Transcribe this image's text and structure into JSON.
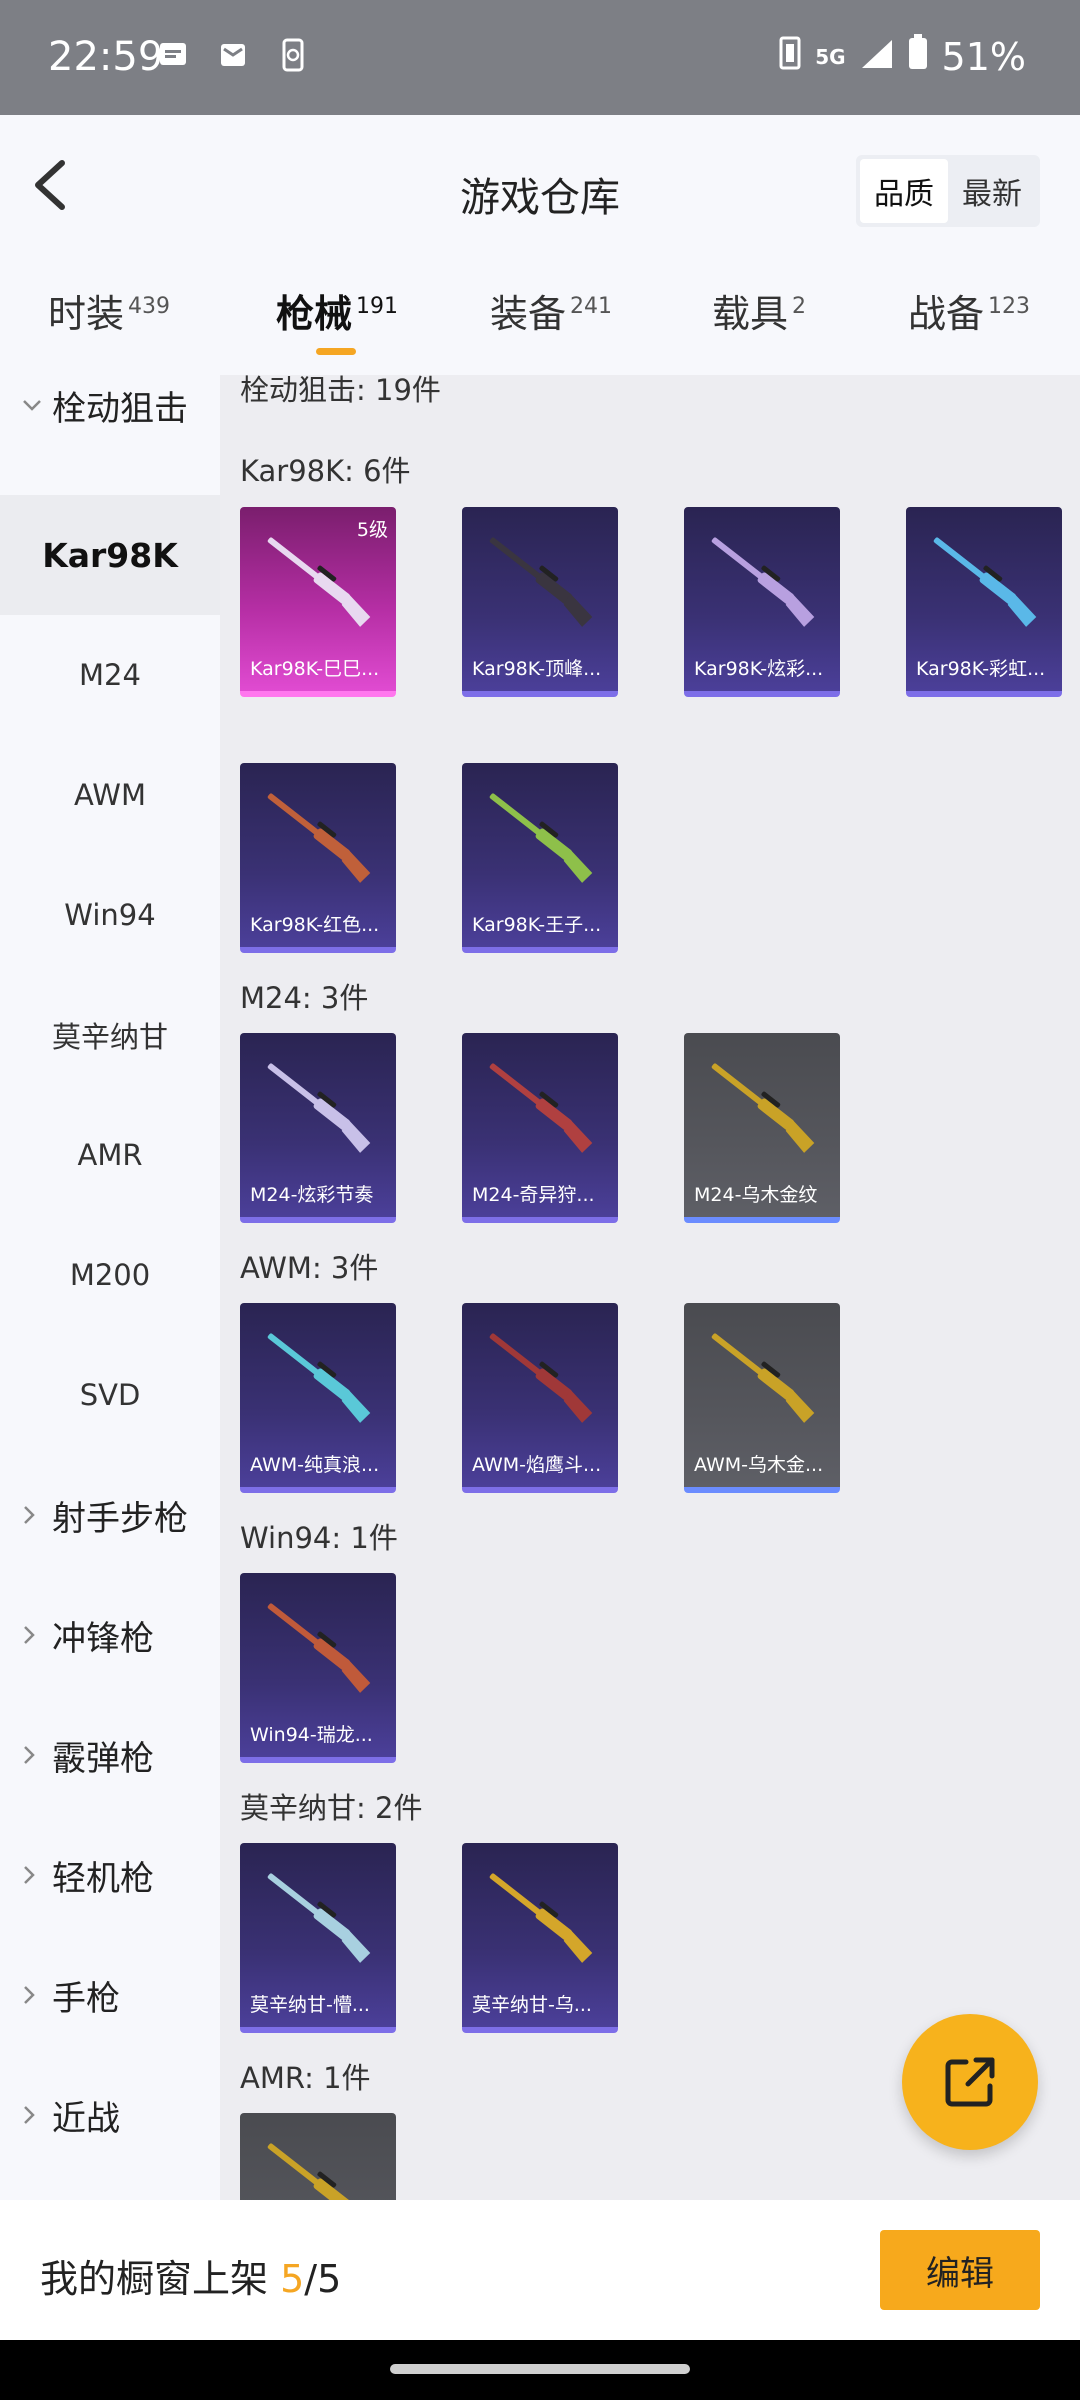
{
  "status_bar": {
    "time": "22:59",
    "icons_left": [
      "message-icon",
      "mail-icon",
      "phone-sync-icon"
    ],
    "network": "5G",
    "battery": "51%"
  },
  "header": {
    "title": "游戏仓库",
    "sort_options": [
      {
        "label": "品质",
        "active": true
      },
      {
        "label": "最新",
        "active": false
      }
    ]
  },
  "tabs": [
    {
      "label": "时装",
      "count": "439",
      "active": false
    },
    {
      "label": "枪械",
      "count": "191",
      "active": true
    },
    {
      "label": "装备",
      "count": "241",
      "active": false
    },
    {
      "label": "载具",
      "count": "2",
      "active": false
    },
    {
      "label": "战备",
      "count": "123",
      "active": false
    }
  ],
  "sidebar": {
    "items": [
      {
        "label": "栓动狙击",
        "type": "group",
        "expanded": true
      },
      {
        "label": "Kar98K",
        "type": "sub",
        "selected": true
      },
      {
        "label": "M24",
        "type": "sub"
      },
      {
        "label": "AWM",
        "type": "sub"
      },
      {
        "label": "Win94",
        "type": "sub"
      },
      {
        "label": "莫辛纳甘",
        "type": "sub"
      },
      {
        "label": "AMR",
        "type": "sub"
      },
      {
        "label": "M200",
        "type": "sub"
      },
      {
        "label": "SVD",
        "type": "sub"
      },
      {
        "label": "射手步枪",
        "type": "group"
      },
      {
        "label": "冲锋枪",
        "type": "group"
      },
      {
        "label": "霰弹枪",
        "type": "group"
      },
      {
        "label": "轻机枪",
        "type": "group"
      },
      {
        "label": "手枪",
        "type": "group"
      },
      {
        "label": "近战",
        "type": "group"
      }
    ]
  },
  "content": {
    "category_header": "栓动狙击: 19件",
    "sections": [
      {
        "title": "Kar98K: 6件",
        "items": [
          {
            "label": "Kar98K-巳巳...",
            "rarity": "pink",
            "level": "5级",
            "gun_color": "#e8d9f0"
          },
          {
            "label": "Kar98K-顶峰...",
            "rarity": "purple",
            "gun_color": "#3a3540"
          },
          {
            "label": "Kar98K-炫彩...",
            "rarity": "purple",
            "gun_color": "#b8a0e0"
          },
          {
            "label": "Kar98K-彩虹...",
            "rarity": "purple",
            "gun_color": "#5ab8e8"
          },
          {
            "label": "Kar98K-红色...",
            "rarity": "purple",
            "gun_color": "#c0603a"
          },
          {
            "label": "Kar98K-王子...",
            "rarity": "purple",
            "gun_color": "#8ec04a"
          }
        ]
      },
      {
        "title": "M24: 3件",
        "items": [
          {
            "label": "M24-炫彩节奏",
            "rarity": "purple",
            "gun_color": "#c8c0e8"
          },
          {
            "label": "M24-奇异狩...",
            "rarity": "purple",
            "gun_color": "#b04040"
          },
          {
            "label": "M24-乌木金纹",
            "rarity": "gray",
            "gun_color": "#c9a227"
          }
        ]
      },
      {
        "title": "AWM: 3件",
        "items": [
          {
            "label": "AWM-纯真浪...",
            "rarity": "purple",
            "gun_color": "#5ac8d8"
          },
          {
            "label": "AWM-焰鹰斗...",
            "rarity": "purple",
            "gun_color": "#a03838"
          },
          {
            "label": "AWM-乌木金...",
            "rarity": "gray",
            "gun_color": "#c9a227"
          }
        ]
      },
      {
        "title": "Win94: 1件",
        "items": [
          {
            "label": "Win94-瑞龙...",
            "rarity": "purple",
            "gun_color": "#c05a3a"
          }
        ]
      },
      {
        "title": "莫辛纳甘: 2件",
        "items": [
          {
            "label": "莫辛纳甘-懵...",
            "rarity": "purple",
            "gun_color": "#a8d0e0"
          },
          {
            "label": "莫辛纳甘-乌...",
            "rarity": "purple",
            "gun_color": "#d4a62a"
          }
        ]
      },
      {
        "title": "AMR: 1件",
        "items": [
          {
            "label": "",
            "rarity": "gray",
            "gun_color": "#c9a227"
          }
        ]
      }
    ]
  },
  "fab": {
    "icon": "share-external-icon"
  },
  "bottom": {
    "showcase_label": "我的橱窗上架",
    "showcase_count": "5",
    "showcase_total": "/5",
    "edit_label": "编辑"
  },
  "colors": {
    "accent": "#f5a623",
    "fab": "#f7b21c"
  }
}
